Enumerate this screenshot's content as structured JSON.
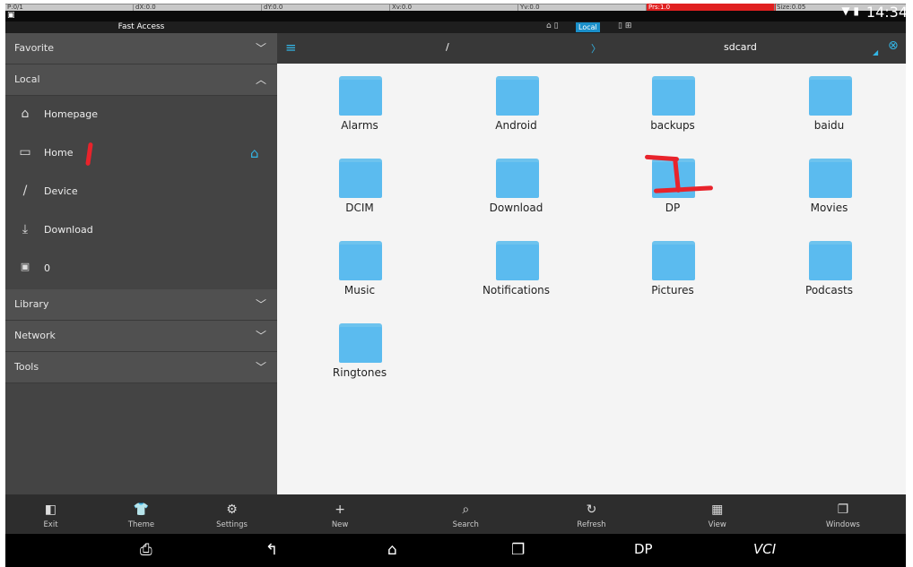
{
  "debug": {
    "pointer": "P:0/1",
    "dx": "dX:0.0",
    "dy": "dY:0.0",
    "xv": "Xv:0.0",
    "yv": "Yv:0.0",
    "prs": "Prs:1.0",
    "size": "Size:0.05"
  },
  "status": {
    "time": "14:34"
  },
  "sidebar": {
    "title": "Fast Access",
    "sections": [
      {
        "label": "Favorite"
      },
      {
        "label": "Local"
      },
      {
        "label": "Library"
      },
      {
        "label": "Network"
      },
      {
        "label": "Tools"
      }
    ],
    "items": [
      {
        "label": "Homepage",
        "icon": "home-outline-icon"
      },
      {
        "label": "Home",
        "icon": "folder-home-icon"
      },
      {
        "label": "Device",
        "icon": "slash-icon"
      },
      {
        "label": "Download",
        "icon": "download-icon"
      },
      {
        "label": "0",
        "icon": "sd-card-icon"
      }
    ]
  },
  "pathbar": {
    "tab_label": "Local"
  },
  "header": {
    "root": "/",
    "folder": "sdcard",
    "separator": "〉"
  },
  "folders": [
    "Alarms",
    "Android",
    "backups",
    "baidu",
    "DCIM",
    "Download",
    "DP",
    "Movies",
    "Music",
    "Notifications",
    "Pictures",
    "Podcasts",
    "Ringtones"
  ],
  "toolbar_left": [
    {
      "label": "Exit",
      "icon": "exit-icon"
    },
    {
      "label": "Theme",
      "icon": "shirt-icon"
    },
    {
      "label": "Settings",
      "icon": "gear-icon"
    }
  ],
  "toolbar_right": [
    {
      "label": "New",
      "icon": "plus-icon"
    },
    {
      "label": "Search",
      "icon": "search-icon"
    },
    {
      "label": "Refresh",
      "icon": "refresh-icon"
    },
    {
      "label": "View",
      "icon": "grid-icon"
    },
    {
      "label": "Windows",
      "icon": "windows-icon"
    }
  ],
  "navbar": {
    "dp": "DP",
    "vci": "VCI"
  },
  "colors": {
    "folder": "#5bbbef",
    "accent": "#33b5e5",
    "annotation": "#e8232b"
  }
}
